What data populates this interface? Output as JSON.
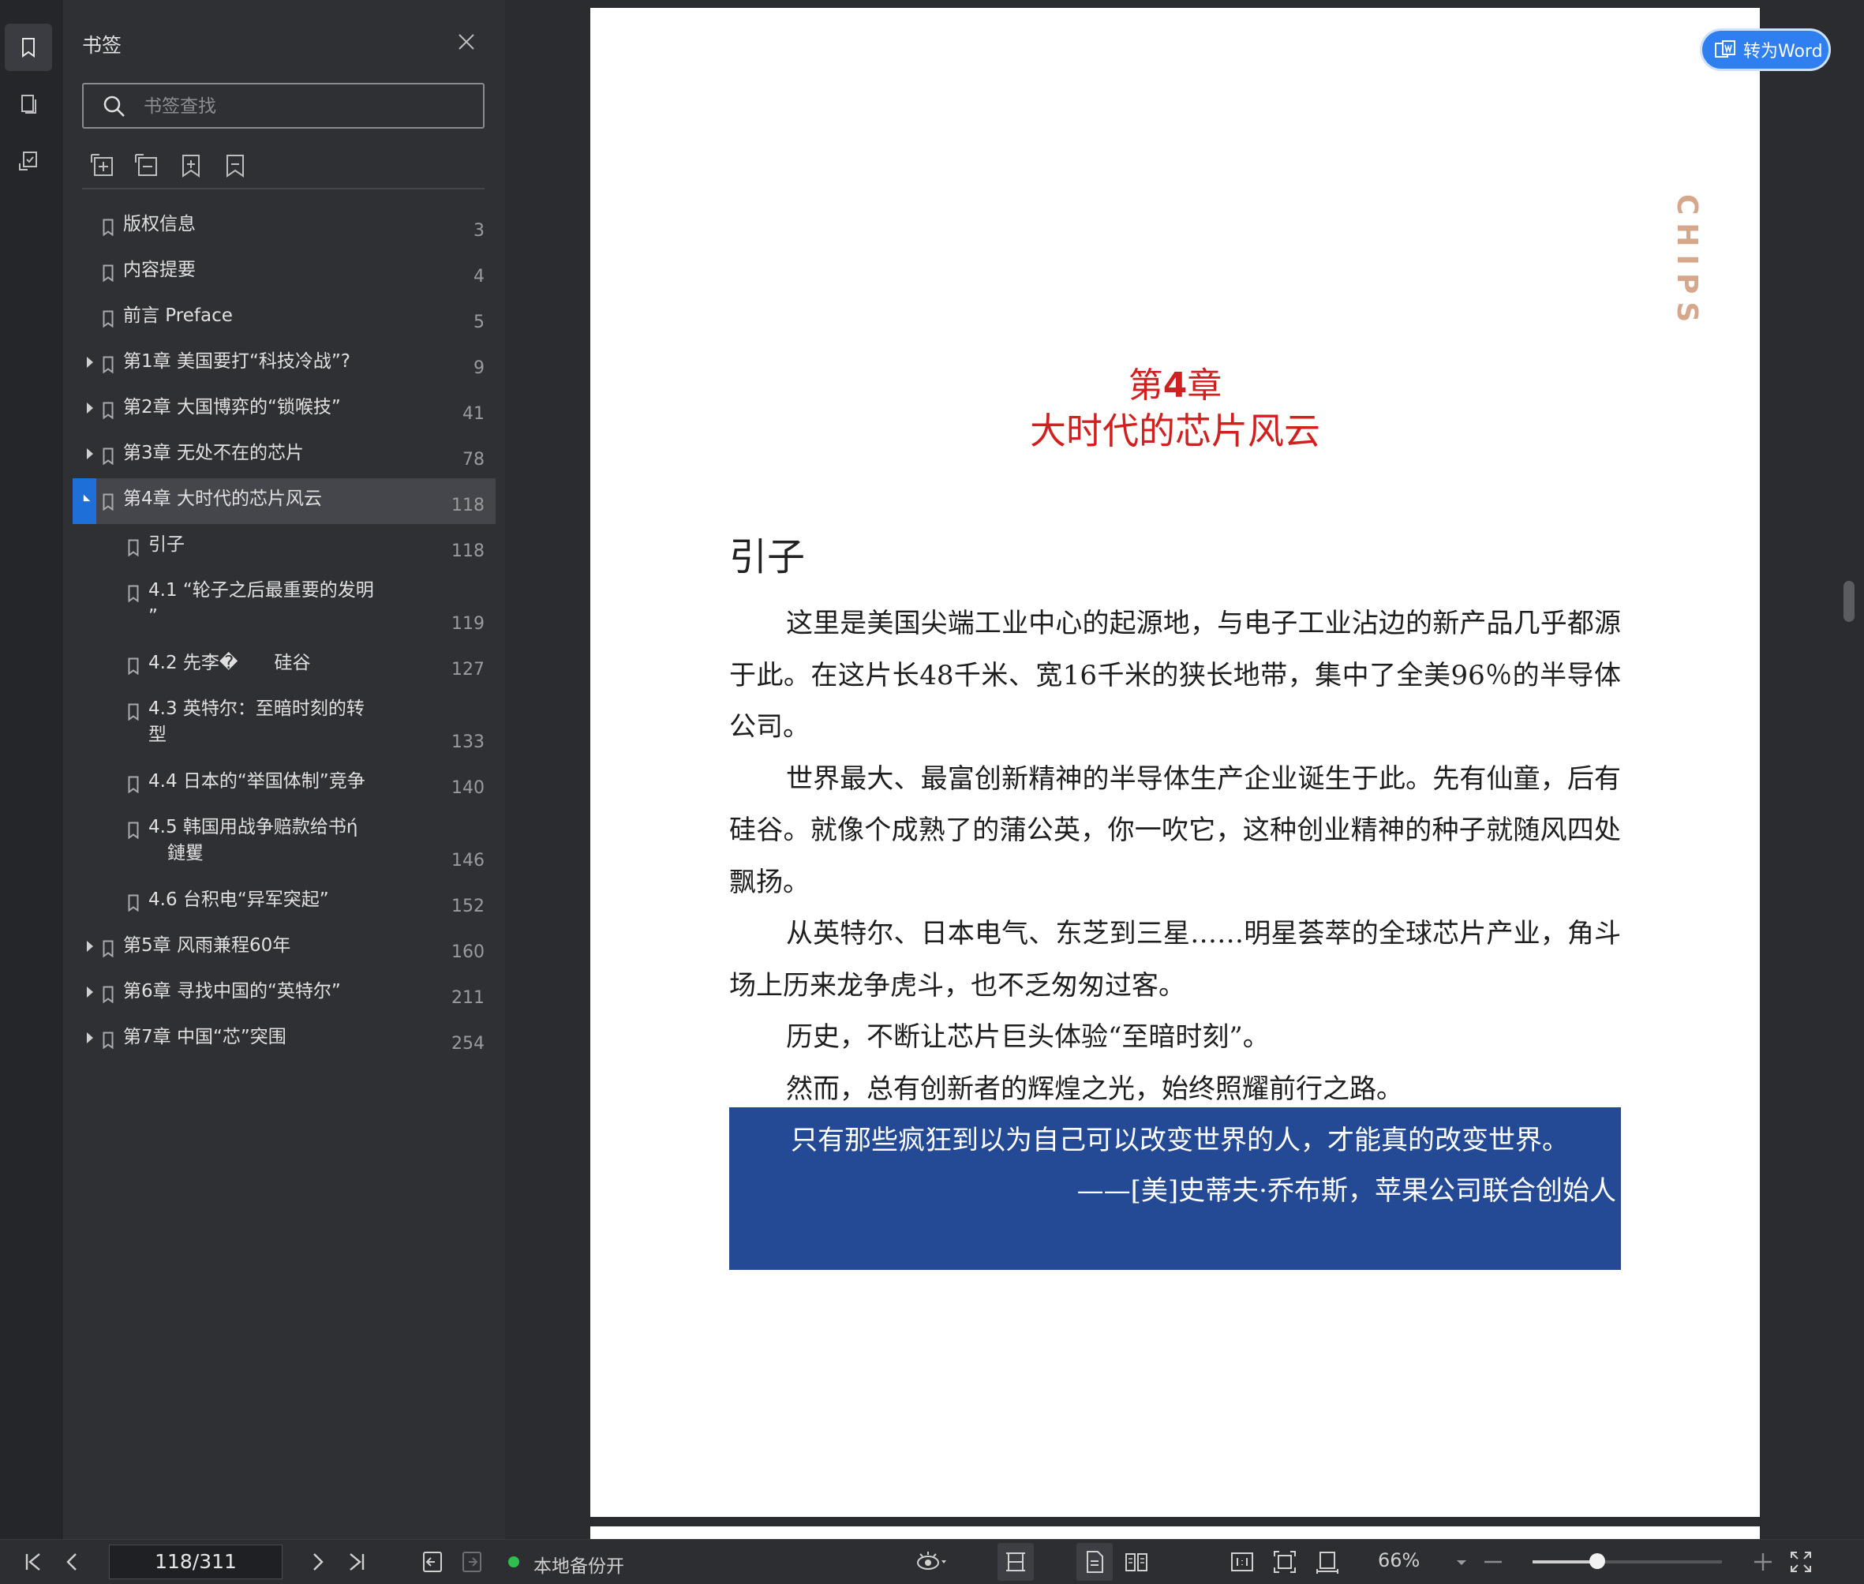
{
  "rail": {
    "items": [
      "bookmark-panel",
      "thumbnails",
      "annotations"
    ]
  },
  "bookmarks": {
    "title": "书签",
    "search_placeholder": "书签查找",
    "tools": [
      "expand-all",
      "collapse-all",
      "add-bookmark",
      "remove-bookmark"
    ],
    "items": [
      {
        "label": "版权信息",
        "page": "3",
        "level": 0,
        "expandable": false
      },
      {
        "label": "内容提要",
        "page": "4",
        "level": 0,
        "expandable": false
      },
      {
        "label": "前言 Preface",
        "page": "5",
        "level": 0,
        "expandable": false
      },
      {
        "label": "第1章 美国要打“科技冷战”?",
        "page": "9",
        "level": 0,
        "expandable": true
      },
      {
        "label": "第2章 大国博弈的“锁喉技”",
        "page": "41",
        "level": 0,
        "expandable": true
      },
      {
        "label": "第3章 无处不在的芯片",
        "page": "78",
        "level": 0,
        "expandable": true
      },
      {
        "label": "第4章 大时代的芯片风云",
        "page": "118",
        "level": 0,
        "expandable": true,
        "expanded": true,
        "selected": true
      },
      {
        "label": "引子",
        "page": "118",
        "level": 1
      },
      {
        "label": "4.1 “轮子之后最重要的发明",
        "label2": "”",
        "page": "119",
        "level": 1
      },
      {
        "label": "4.2 先李�　　硅谷",
        "page": "127",
        "level": 1
      },
      {
        "label": "4.3 英特尔：至暗时刻的转",
        "label2": "型",
        "page": "133",
        "level": 1
      },
      {
        "label": "4.4 日本的“举国体制”竞争",
        "page": "140",
        "level": 1
      },
      {
        "label": "4.5 韩国用战争赔款给书ή",
        "label2": "鏈矍",
        "page": "146",
        "level": 1
      },
      {
        "label": "4.6 台积电“异军突起”",
        "page": "152",
        "level": 1
      },
      {
        "label": "第5章 风雨兼程60年",
        "page": "160",
        "level": 0,
        "expandable": true
      },
      {
        "label": "第6章 寻找中国的“英特尔”",
        "page": "211",
        "level": 0,
        "expandable": true
      },
      {
        "label": "第7章 中国“芯”突围",
        "page": "254",
        "level": 0,
        "expandable": true
      }
    ]
  },
  "document": {
    "convert_button": "转为Word",
    "side_mark": "CHIPS",
    "chapter_prefix": "第",
    "chapter_number": "4",
    "chapter_suffix": "章",
    "chapter_title": "大时代的芯片风云",
    "section_title": "引子",
    "paragraphs": [
      "这里是美国尖端工业中心的起源地，与电子工业沾边的新产品几乎都源于此。在这片长48千米、宽16千米的狭长地带，集中了全美96％的半导体公司。",
      "世界最大、最富创新精神的半导体生产企业诞生于此。先有仙童，后有硅谷。就像个成熟了的蒲公英，你一吹它，这种创业精神的种子就随风四处飘扬。",
      "从英特尔、日本电气、东芝到三星……明星荟萃的全球芯片产业，角斗场上历来龙争虎斗，也不乏匆匆过客。",
      "历史，不断让芯片巨头体验“至暗时刻”。",
      "然而，总有创新者的辉煌之光，始终照耀前行之路。"
    ],
    "quote_text": "只有那些疯狂到以为自己可以改变世界的人，才能真的改变世界。",
    "quote_attribution": "——[美]史蒂夫·乔布斯，苹果公司联合创始人"
  },
  "statusbar": {
    "page_indicator": "118/311",
    "backup_label": "本地备份开",
    "zoom": "66%",
    "zoom_level": 0.34
  },
  "colors": {
    "accent": "#1f6fd8",
    "chapter_red": "#d02020",
    "quote_bg": "#244a96",
    "chips_mark": "#d7a78c",
    "backup_green": "#2fbf4f"
  }
}
